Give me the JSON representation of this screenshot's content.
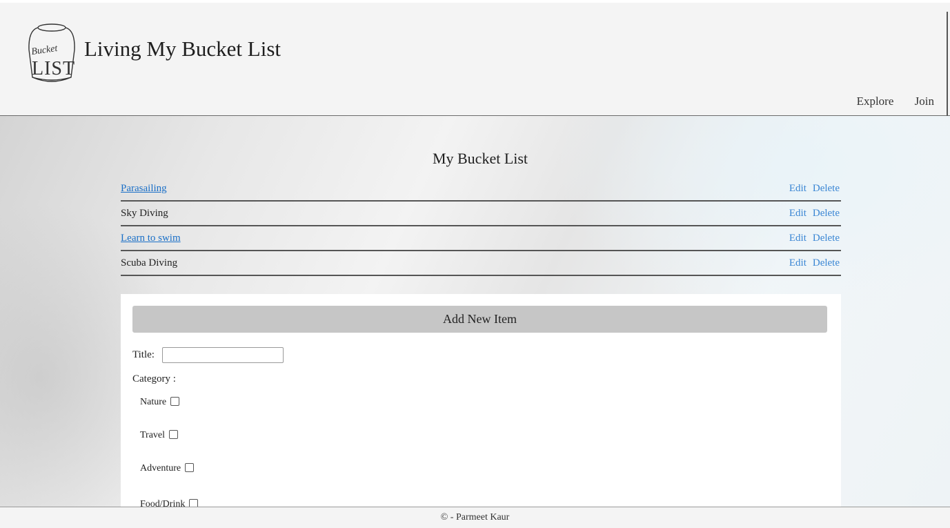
{
  "header": {
    "logo_text": "Bucket List",
    "site_title": "Living My Bucket List",
    "nav": [
      "Explore",
      "Join"
    ]
  },
  "main": {
    "list_title": "My Bucket List",
    "items": [
      {
        "title": "Parasailing",
        "is_link": true
      },
      {
        "title": "Sky Diving",
        "is_link": false
      },
      {
        "title": "Learn to swim",
        "is_link": true
      },
      {
        "title": "Scuba Diving",
        "is_link": false
      }
    ],
    "edit_label": "Edit",
    "delete_label": "Delete"
  },
  "form": {
    "header": "Add New Item",
    "title_label": "Title:",
    "title_value": "",
    "category_label": "Category :",
    "categories": [
      {
        "label": "Nature",
        "checked": false
      },
      {
        "label": "Travel",
        "checked": false
      },
      {
        "label": "Adventure",
        "checked": false
      },
      {
        "label": "Food/Drink",
        "checked": false
      }
    ]
  },
  "footer": {
    "text": "© - Parmeet Kaur"
  },
  "colors": {
    "link": "#1a6fc7",
    "action": "#3a86d4",
    "form_header_bg": "#c6c6c6",
    "header_bg": "#f4f4f4"
  }
}
